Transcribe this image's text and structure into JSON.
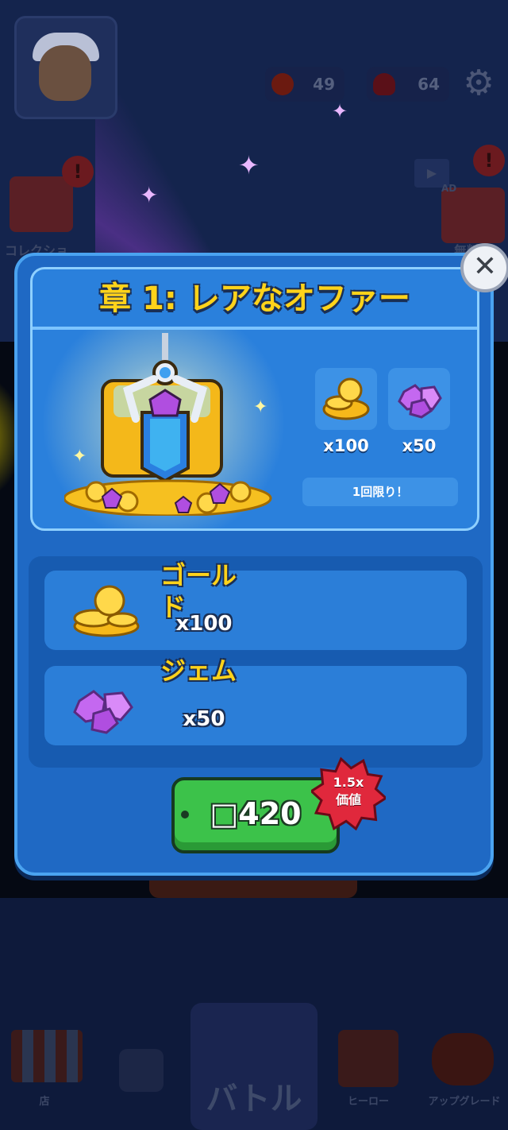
{
  "background": {
    "resources": [
      {
        "icon": "coin-icon",
        "value": "49",
        "color": "#6b1a10"
      },
      {
        "icon": "mushroom-icon",
        "value": "64",
        "color": "#5a1018"
      }
    ],
    "left_menu_label": "コレクショ",
    "right_menu_badge": "AD",
    "right_menu_label": "無料",
    "nav": {
      "shop": "店",
      "battle": "バトル",
      "heroes": "ヒーロー",
      "upgrade": "アップグレード"
    }
  },
  "modal": {
    "title": "章 1: レアなオファー",
    "rewards": [
      {
        "icon": "gold-coins-icon",
        "qty": "x100"
      },
      {
        "icon": "purple-gems-icon",
        "qty": "x50"
      }
    ],
    "limit_text": "1回限り！",
    "items": [
      {
        "icon": "gold-coins-icon",
        "name": "ゴールド",
        "qty": "x100"
      },
      {
        "icon": "purple-gems-icon",
        "name": "ジェム",
        "qty": "x50"
      }
    ],
    "buy_price": "□420",
    "value_badge": "1.5x\n価値",
    "value_badge_line1": "1.5x",
    "value_badge_line2": "価値",
    "close_symbol": "✕"
  },
  "colors": {
    "title_yellow": "#ffd31a",
    "modal_blue": "#1f69c4",
    "buy_green": "#3cc24a",
    "badge_red": "#e0283c"
  }
}
